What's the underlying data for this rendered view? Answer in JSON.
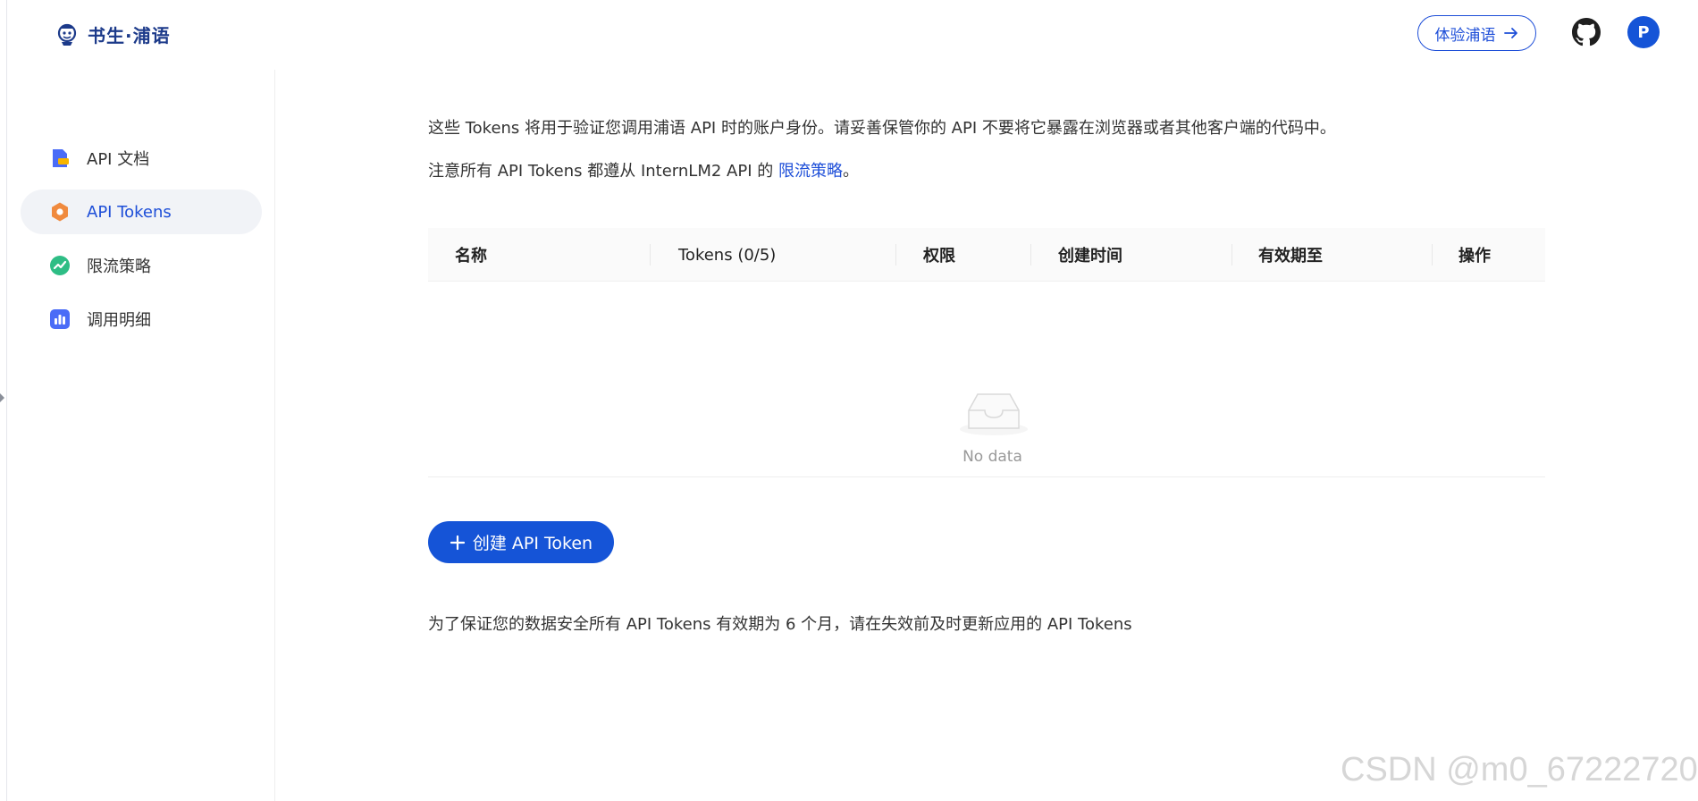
{
  "header": {
    "logo_text": "书生·浦语",
    "try_button_label": "体验浦语",
    "avatar_letter": "P"
  },
  "sidebar": {
    "items": [
      {
        "label": "API 文档",
        "icon": "doc-icon"
      },
      {
        "label": "API Tokens",
        "icon": "token-icon",
        "active": true
      },
      {
        "label": "限流策略",
        "icon": "rate-limit-icon"
      },
      {
        "label": "调用明细",
        "icon": "bar-chart-icon"
      }
    ]
  },
  "main": {
    "description_1": "这些 Tokens 将用于验证您调用浦语 API 时的账户身份。请妥善保管你的 API 不要将它暴露在浏览器或者其他客户端的代码中。",
    "description_2_prefix": "注意所有 API Tokens 都遵从 InternLM2 API 的 ",
    "description_2_link": "限流策略",
    "description_2_suffix": "。",
    "table": {
      "columns": [
        "名称",
        "Tokens (0/5)",
        "权限",
        "创建时间",
        "有效期至",
        "操作"
      ],
      "rows": [],
      "empty_text": "No data"
    },
    "create_button_label": "创建 API Token",
    "footnote": "为了保证您的数据安全所有 API Tokens 有效期为 6 个月，请在失效前及时更新应用的 API Tokens"
  },
  "watermark": "CSDN @m0_67222720",
  "colors": {
    "accent": "#1554d7",
    "link": "#1d4ed8",
    "active_bg": "#f1f3f7"
  }
}
